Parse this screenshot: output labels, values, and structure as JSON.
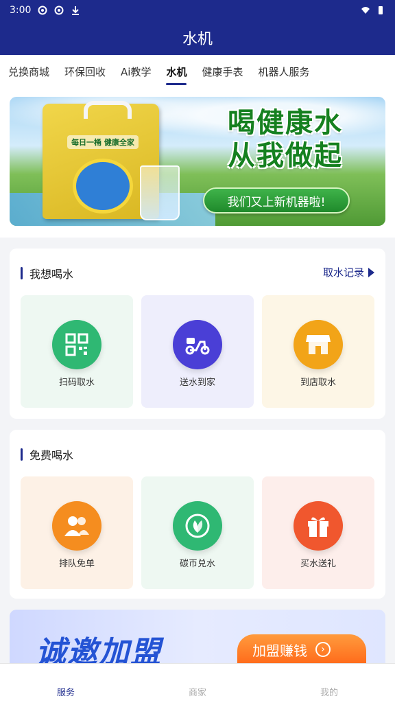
{
  "status_bar": {
    "time": "3:00"
  },
  "app_bar": {
    "title": "水机"
  },
  "tabs": [
    {
      "label": "兑换商城"
    },
    {
      "label": "环保回收"
    },
    {
      "label": "Ai教学"
    },
    {
      "label": "水机",
      "active": true
    },
    {
      "label": "健康手表"
    },
    {
      "label": "机器人服务"
    }
  ],
  "banner": {
    "title_line1": "喝健康水",
    "title_line2": "从我做起",
    "pill_text": "我们又上新机器啦!",
    "bag_text": "每日一桶 健康全家"
  },
  "section_drink": {
    "title": "我想喝水",
    "link_label": "取水记录",
    "tiles": [
      {
        "label": "扫码取水",
        "icon": "qr-code-icon",
        "bg": "#eef8f2",
        "circle": "#2fb873"
      },
      {
        "label": "送水到家",
        "icon": "scooter-icon",
        "bg": "#eeeefc",
        "circle": "#4a3fd6"
      },
      {
        "label": "到店取水",
        "icon": "store-icon",
        "bg": "#fdf6e6",
        "circle": "#f2a418"
      }
    ]
  },
  "section_free": {
    "title": "免费喝水",
    "tiles": [
      {
        "label": "排队免单",
        "icon": "people-icon",
        "bg": "#fdf1e6",
        "circle": "#f58d1f"
      },
      {
        "label": "碳币兑水",
        "icon": "leaf-icon",
        "bg": "#eef8f2",
        "circle": "#2fb873"
      },
      {
        "label": "买水送礼",
        "icon": "gift-icon",
        "bg": "#fdeeeb",
        "circle": "#f0572e"
      }
    ]
  },
  "promo": {
    "text": "诚邀加盟",
    "button": "加盟赚钱"
  },
  "bottom_nav": [
    {
      "label": "服务",
      "active": true
    },
    {
      "label": "商家"
    },
    {
      "label": "我的"
    }
  ],
  "colors": {
    "primary": "#1d2a8c",
    "page_bg": "#f3f4f7"
  }
}
